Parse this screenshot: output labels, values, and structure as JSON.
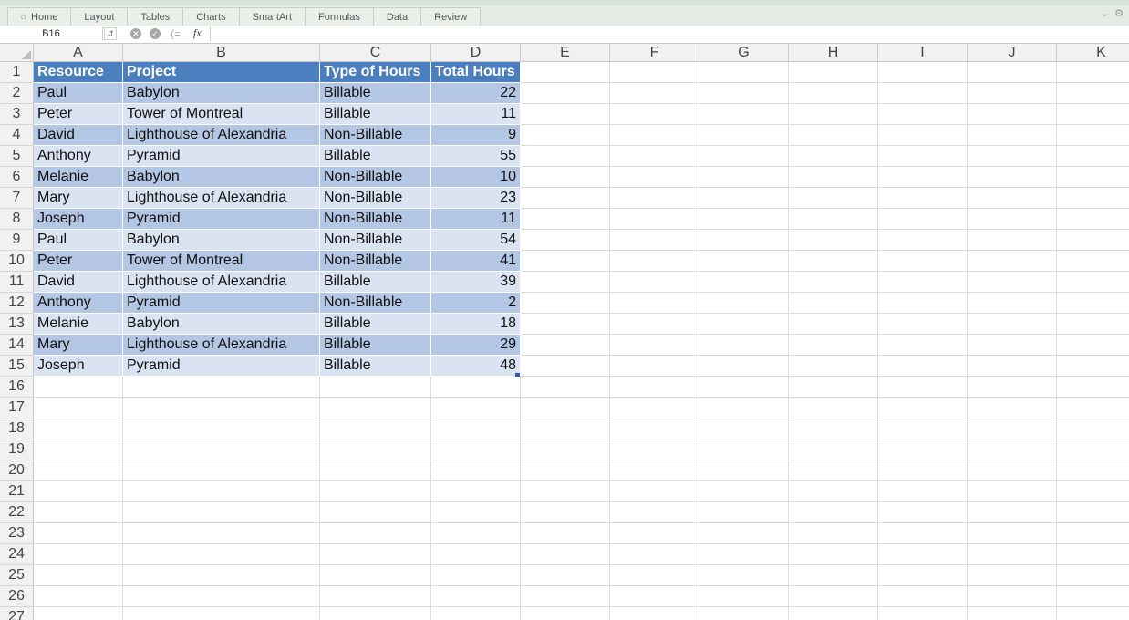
{
  "ribbon": {
    "tabs": [
      "Home",
      "Layout",
      "Tables",
      "Charts",
      "SmartArt",
      "Formulas",
      "Data",
      "Review"
    ],
    "icons": [
      "home-icon",
      "collapse-ribbon-icon",
      "settings-icon"
    ]
  },
  "formula_bar": {
    "name_box": "B16",
    "fx_label": "fx",
    "formula": ""
  },
  "columns": [
    "A",
    "B",
    "C",
    "D",
    "E",
    "F",
    "G",
    "H",
    "I",
    "J",
    "K"
  ],
  "rows": [
    "1",
    "2",
    "3",
    "4",
    "5",
    "6",
    "7",
    "8",
    "9",
    "10",
    "11",
    "12",
    "13",
    "14",
    "15",
    "16",
    "17",
    "18",
    "19",
    "20",
    "21",
    "22",
    "23",
    "24",
    "25",
    "26",
    "27"
  ],
  "table": {
    "headers": [
      "Resource",
      "Project",
      "Type of Hours",
      "Total Hours"
    ],
    "rows": [
      [
        "Paul",
        "Babylon",
        "Billable",
        "22"
      ],
      [
        "Peter",
        "Tower of Montreal",
        "Billable",
        "11"
      ],
      [
        "David",
        "Lighthouse of Alexandria",
        "Non-Billable",
        "9"
      ],
      [
        "Anthony",
        "Pyramid",
        "Billable",
        "55"
      ],
      [
        "Melanie",
        "Babylon",
        "Non-Billable",
        "10"
      ],
      [
        "Mary",
        "Lighthouse of Alexandria",
        "Non-Billable",
        "23"
      ],
      [
        "Joseph",
        "Pyramid",
        "Non-Billable",
        "11"
      ],
      [
        "Paul",
        "Babylon",
        "Non-Billable",
        "54"
      ],
      [
        "Peter",
        "Tower of Montreal",
        "Non-Billable",
        "41"
      ],
      [
        "David",
        "Lighthouse of Alexandria",
        "Billable",
        "39"
      ],
      [
        "Anthony",
        "Pyramid",
        "Non-Billable",
        "2"
      ],
      [
        "Melanie",
        "Babylon",
        "Billable",
        "18"
      ],
      [
        "Mary",
        "Lighthouse of Alexandria",
        "Billable",
        "29"
      ],
      [
        "Joseph",
        "Pyramid",
        "Billable",
        "48"
      ]
    ]
  },
  "colors": {
    "table_header": "#4a7ebf",
    "band_dark": "#b3c6e3",
    "band_light": "#dae3f1"
  }
}
